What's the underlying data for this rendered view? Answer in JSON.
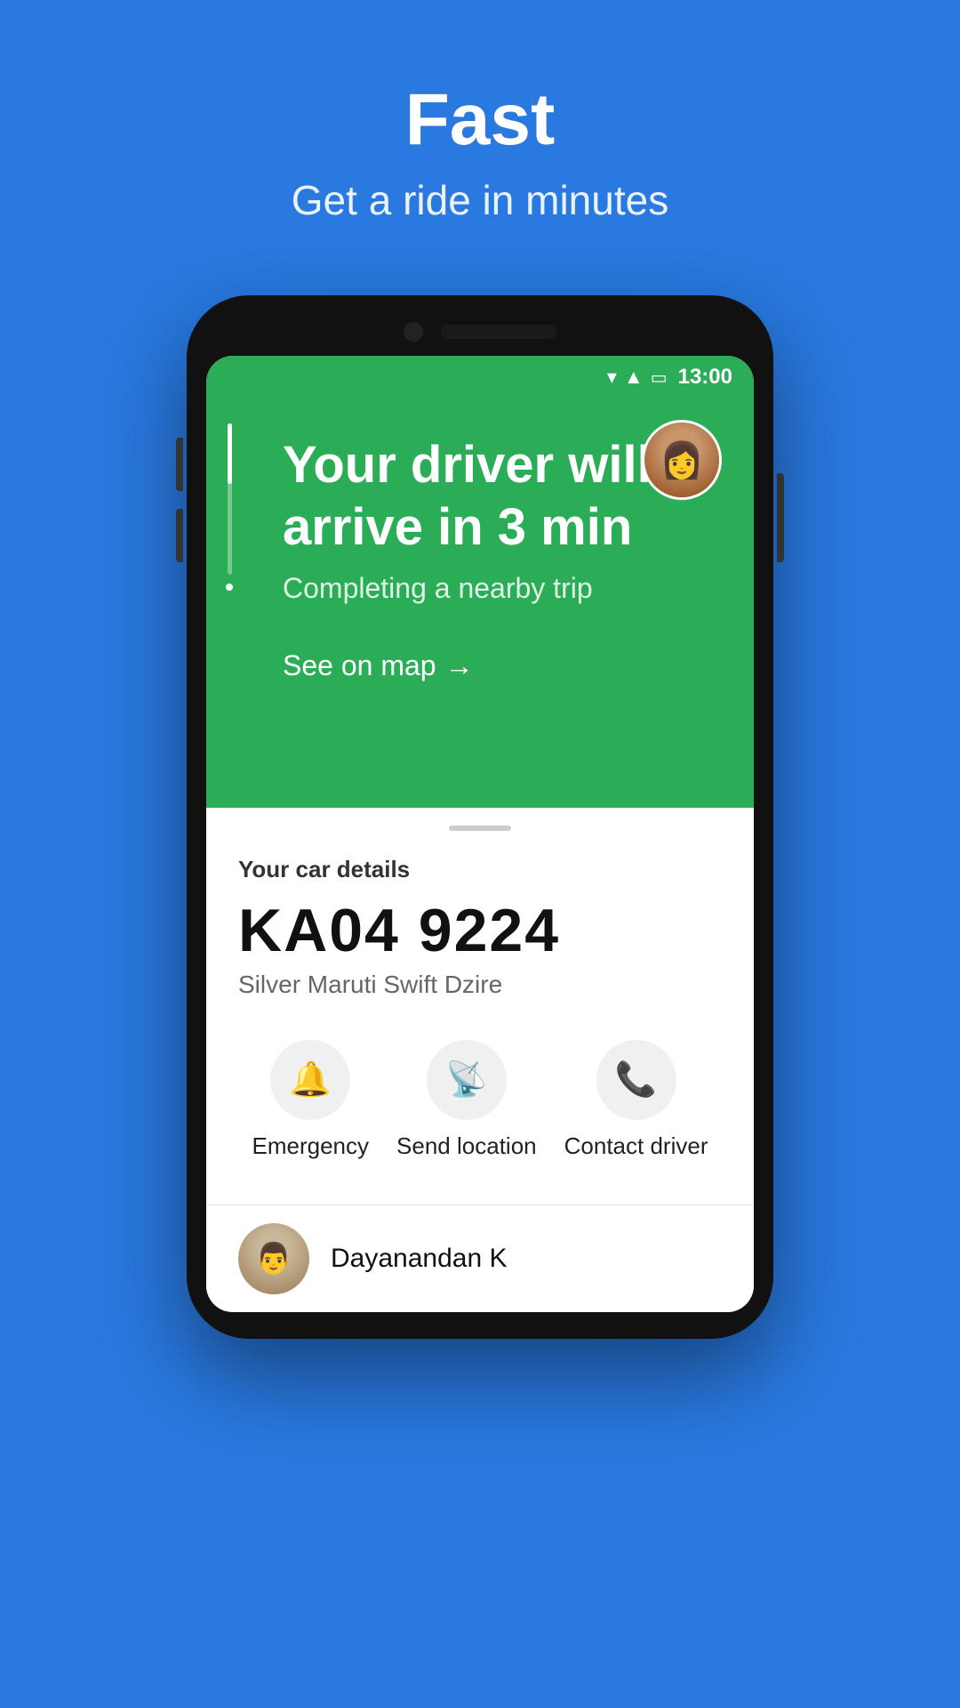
{
  "header": {
    "title": "Fast",
    "subtitle": "Get a ride in minutes"
  },
  "phone": {
    "status_bar": {
      "time": "13:00"
    },
    "green_card": {
      "arrival_line1": "Your driver will",
      "arrival_line2": "arrive in 3 min",
      "completing_trip": "Completing a nearby trip",
      "see_on_map": "See on map"
    },
    "white_card": {
      "car_details_label": "Your car details",
      "car_plate": "KA04 9224",
      "car_model": "Silver Maruti Swift Dzire"
    },
    "action_buttons": [
      {
        "icon": "🔔",
        "label": "Emergency"
      },
      {
        "icon": "📡",
        "label": "Send location"
      },
      {
        "icon": "📞",
        "label": "Contact driver"
      }
    ],
    "driver": {
      "name": "Dayanandan K"
    }
  }
}
